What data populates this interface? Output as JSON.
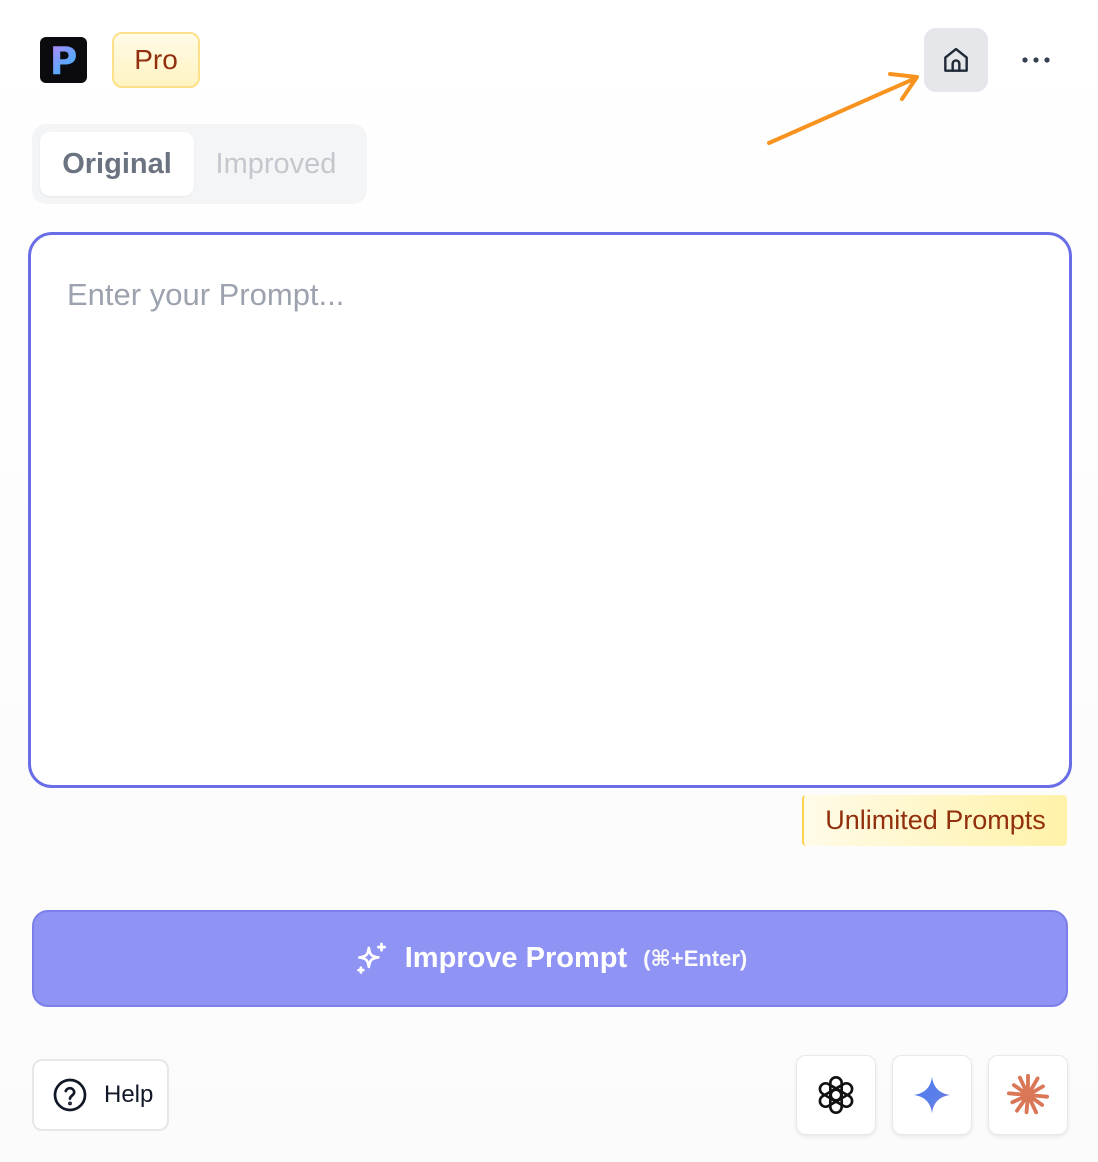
{
  "header": {
    "logo_letter": "P",
    "plan_badge": "Pro",
    "home_icon": "home-icon",
    "more_icon": "more-horizontal-icon"
  },
  "tabs": [
    {
      "label": "Original",
      "active": true
    },
    {
      "label": "Improved",
      "active": false
    }
  ],
  "prompt": {
    "placeholder": "Enter your Prompt...",
    "value": ""
  },
  "usage_badge": "Unlimited Prompts",
  "improve_button": {
    "icon": "sparkles-icon",
    "label": "Improve Prompt",
    "shortcut": "(⌘+Enter)"
  },
  "footer": {
    "help_icon": "question-circle-icon",
    "help_label": "Help",
    "models": [
      "chatgpt-icon",
      "gemini-icon",
      "claude-icon"
    ]
  },
  "colors": {
    "accent": "#6a6ee6",
    "button": "#8f93f4",
    "badge_text": "#92300e",
    "annotation": "#f7931e"
  }
}
